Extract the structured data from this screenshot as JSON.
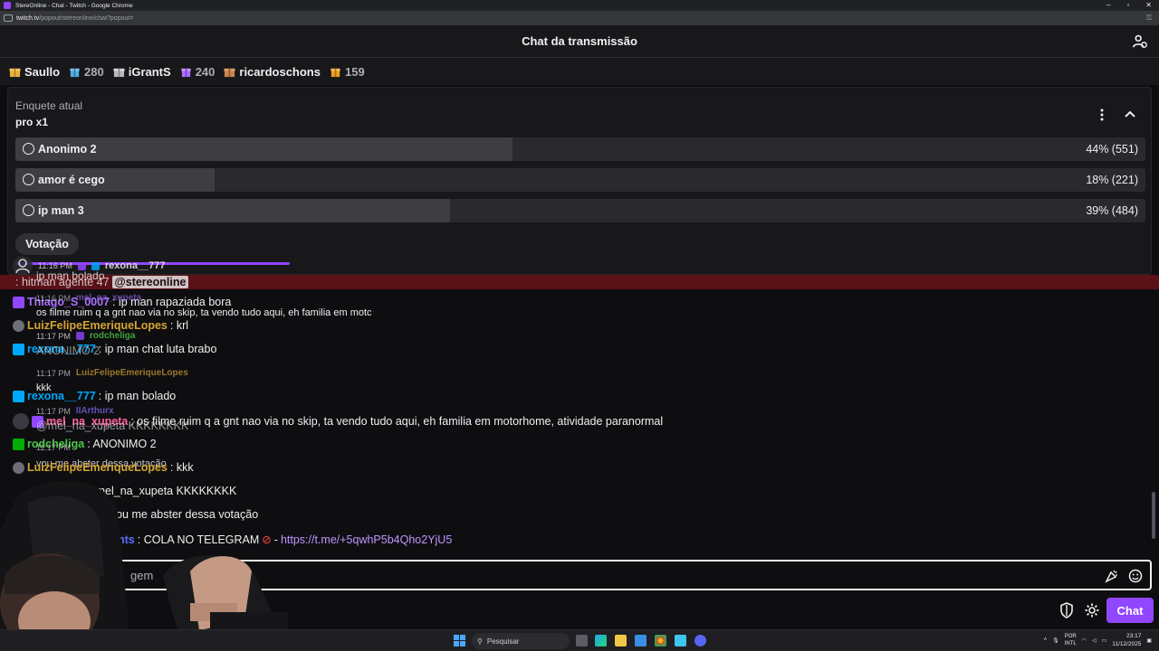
{
  "window": {
    "title": "StereOnline - Chat - Twitch - Google Chrome",
    "url_host": "twitch.tv",
    "url_path": "/popout/stereonline/chat?popout="
  },
  "header": {
    "title": "Chat da transmissão"
  },
  "leaderboard": [
    {
      "name": "Saullo",
      "score": ""
    },
    {
      "name": "",
      "score": "280"
    },
    {
      "name": "iGrantS",
      "score": ""
    },
    {
      "name": "",
      "score": "240"
    },
    {
      "name": "ricardoschons",
      "score": ""
    },
    {
      "name": "",
      "score": "159"
    }
  ],
  "poll": {
    "label": "Enquete atual",
    "question": "pro x1",
    "options": [
      {
        "text": "Anonimo 2",
        "percent_text": "44% (551)",
        "fill": 0.44
      },
      {
        "text": "amor é cego",
        "percent_text": "18% (221)",
        "fill": 0.176
      },
      {
        "text": "ip man 3",
        "percent_text": "39% (484)",
        "fill": 0.385
      }
    ],
    "vote_label": "Votação",
    "vote_progress": 0.24
  },
  "overlay": {
    "first_time": "11:16 PM",
    "first_user": "rexona__777",
    "first_text": "ip man bolado"
  },
  "messages": [
    {
      "user": "",
      "text": ": hitman agente 47",
      "mention": "@stereonline",
      "color": "#ff4a4a"
    },
    {
      "user": "Thiago_S_0007",
      "text": ": ip man rapaziada bora",
      "color": "#a970ff"
    },
    {
      "user": "",
      "text": "os filme ruim q a gnt nao via no skip, ta vendo tudo aqui, eh familia em motc",
      "color": "#efeff1"
    },
    {
      "user": "LuizFelipeEmeriqueLopes",
      "text": ": krl",
      "color": "#d6a436"
    },
    {
      "user": "rexona__777",
      "text": ": ip man chat luta brabo",
      "color": "#00a8fc"
    },
    {
      "user": "",
      "text": "ANONIMO 2",
      "color": "#efeff1"
    },
    {
      "user": "",
      "text": "kkk",
      "color": "#efeff1"
    },
    {
      "user": "rexona__777",
      "text": ": ip man bolado",
      "color": "#00a8fc"
    },
    {
      "user": "mel_na_xupeta",
      "text": ": os filme ruim q a gnt nao via no skip, ta vendo tudo aqui, eh familia em motorhome, atividade paranormal",
      "color": "#ff5fa2"
    },
    {
      "user": "",
      "text": "@mel_na_xupeta KKKKKKKK",
      "color": "#efeff1"
    },
    {
      "user": "rodcheliga",
      "text": ": ANONIMO 2",
      "color": "#4cc747"
    },
    {
      "user": "",
      "text": "vou me abster dessa votação",
      "color": "#efeff1"
    },
    {
      "user": "LuizFelipeEmeriqueLopes",
      "text": ": kkk",
      "color": "#d6a436"
    },
    {
      "user": "",
      "text": ": @mel_na_xupeta KKKKKKKK",
      "color": "#efeff1"
    },
    {
      "user": "12",
      "text": ": vou me abster dessa votação",
      "color": "#5b6dff"
    },
    {
      "user": "nts",
      "text": ": COLA NO TELEGRAM",
      "color": "#5b6dff"
    }
  ],
  "telegram_link": "https://t.me/+5qwhP5b4Qho2YjU5",
  "overlay_lines": [
    {
      "time": "11:16 PM",
      "user": "mel_na_xupeta"
    },
    {
      "time": "11:17 PM",
      "user": "rodcheliga"
    },
    {
      "time": "11:17 PM",
      "user": "LuizFelipeEmeriqueLopes"
    },
    {
      "time": "11:17 PM",
      "user": "IIArthurx"
    },
    {
      "time": "11:17 PM",
      "user": ""
    }
  ],
  "input": {
    "placeholder_tail": "gem"
  },
  "controls": {
    "chat_label": "Chat"
  },
  "taskbar": {
    "search": "Pesquisar",
    "lang_top": "POR",
    "lang_bottom": "INTL",
    "time": "23:17",
    "date": "11/12/2025"
  },
  "colors": {
    "accent": "#9146ff",
    "bg": "#0e0e10"
  }
}
